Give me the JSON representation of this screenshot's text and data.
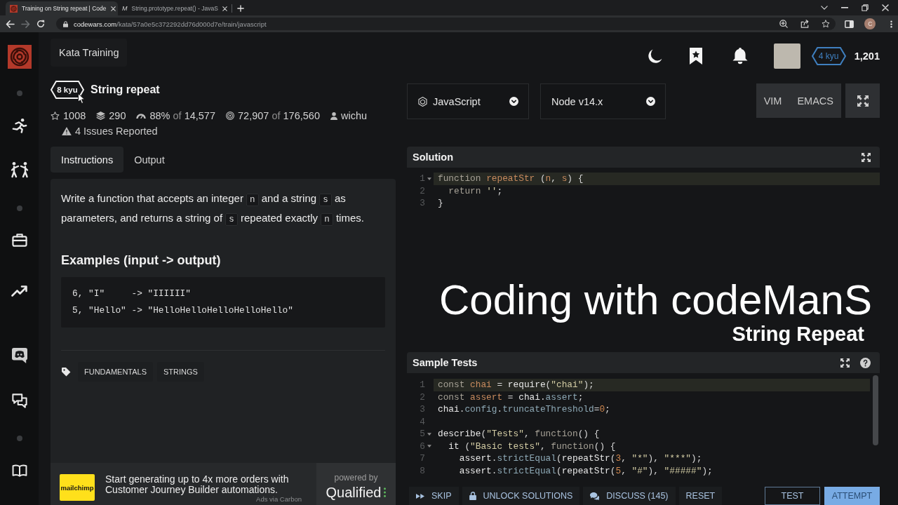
{
  "browser": {
    "tabs": [
      {
        "favicon": {
          "kind": "logo"
        },
        "title": "Training on String repeat | Code",
        "selected": true
      },
      {
        "favicon": {
          "kind": "letter",
          "text": "M"
        },
        "title": "String.prototype.repeat() - JavaS",
        "selected": false
      }
    ],
    "nav": {
      "back_disabled": false,
      "forward_disabled": true
    },
    "address": {
      "domain": "codewars.com",
      "path": "/kata/57a0e5c372292dd76d000d7e/train/javascript"
    },
    "profile_initial": "C"
  },
  "topbar": {
    "title": "Kata Training",
    "rank": "4 kyu",
    "honor": "1,201"
  },
  "kata": {
    "rank": "8 kyu",
    "title": "String repeat",
    "stats": [
      {
        "kind": "stars",
        "value": "1008"
      },
      {
        "kind": "collections",
        "value": "290"
      },
      {
        "kind": "satisfaction",
        "value": "88%",
        "of": "of",
        "total": "14,577"
      },
      {
        "kind": "completions",
        "value": "72,907",
        "of": "of",
        "total": "176,560"
      },
      {
        "kind": "author",
        "value": "wichu"
      }
    ],
    "issues": "4 Issues Reported"
  },
  "tabs": [
    {
      "label": "Instructions",
      "selected": true
    },
    {
      "label": "Output",
      "selected": false
    }
  ],
  "instructions": {
    "paragraph": [
      {
        "kind": "text",
        "text": "Write a function that accepts an integer "
      },
      {
        "kind": "code",
        "text": "n"
      },
      {
        "kind": "text",
        "text": " and a string "
      },
      {
        "kind": "code",
        "text": "s"
      },
      {
        "kind": "text",
        "text": " as parameters, and returns a string of "
      },
      {
        "kind": "code",
        "text": "s"
      },
      {
        "kind": "text",
        "text": " repeated exactly "
      },
      {
        "kind": "code",
        "text": "n"
      },
      {
        "kind": "text",
        "text": " times."
      }
    ],
    "examples_heading": "Examples (input -> output)",
    "examples": [
      "6, \"I\"     -> \"IIIIII\"",
      "5, \"Hello\" -> \"HelloHelloHelloHelloHello\""
    ],
    "tags": [
      "FUNDAMENTALS",
      "STRINGS"
    ]
  },
  "ad": {
    "logo": "mailchimp",
    "text": "Start generating up to 4x more orders with Customer Journey Builder automations.",
    "credit": "Ads via Carbon",
    "powered_by": "powered by",
    "sponsor": "Qualified"
  },
  "editor": {
    "language": "JavaScript",
    "version": "Node v14.x",
    "modes": [
      {
        "label": "VIM",
        "selected": false
      },
      {
        "label": "EMACS",
        "selected": false
      }
    ]
  },
  "solution": {
    "title": "Solution",
    "lines": [
      {
        "number": "1",
        "foldable": true,
        "active": true,
        "tokens": [
          {
            "kind": "keyword",
            "text": "function "
          },
          {
            "kind": "def",
            "text": "repeatStr"
          },
          {
            "kind": "punct",
            "text": " ("
          },
          {
            "kind": "param",
            "text": "n"
          },
          {
            "kind": "punct",
            "text": ", "
          },
          {
            "kind": "param",
            "text": "s"
          },
          {
            "kind": "punct",
            "text": ") {"
          }
        ]
      },
      {
        "number": "2",
        "foldable": false,
        "active": false,
        "tokens": [
          {
            "kind": "keyword",
            "text": "  return "
          },
          {
            "kind": "string",
            "text": "''"
          },
          {
            "kind": "punct",
            "text": ";"
          }
        ]
      },
      {
        "number": "3",
        "foldable": false,
        "active": false,
        "tokens": [
          {
            "kind": "punct",
            "text": "}"
          }
        ]
      }
    ]
  },
  "overlay": {
    "title": "Coding with codeManS",
    "subtitle": "String Repeat"
  },
  "sample_tests": {
    "title": "Sample Tests",
    "lines": [
      {
        "number": "1",
        "foldable": false,
        "active": true,
        "tokens": [
          {
            "kind": "keyword",
            "text": "const "
          },
          {
            "kind": "def",
            "text": "chai"
          },
          {
            "kind": "punct",
            "text": " = "
          },
          {
            "kind": "variable",
            "text": "require"
          },
          {
            "kind": "punct",
            "text": "("
          },
          {
            "kind": "string",
            "text": "\"chai\""
          },
          {
            "kind": "punct",
            "text": ");"
          }
        ]
      },
      {
        "number": "2",
        "foldable": false,
        "active": false,
        "tokens": [
          {
            "kind": "keyword",
            "text": "const "
          },
          {
            "kind": "def",
            "text": "assert"
          },
          {
            "kind": "punct",
            "text": " = "
          },
          {
            "kind": "variable",
            "text": "chai"
          },
          {
            "kind": "punct",
            "text": "."
          },
          {
            "kind": "property",
            "text": "assert"
          },
          {
            "kind": "punct",
            "text": ";"
          }
        ]
      },
      {
        "number": "3",
        "foldable": false,
        "active": false,
        "tokens": [
          {
            "kind": "variable",
            "text": "chai"
          },
          {
            "kind": "punct",
            "text": "."
          },
          {
            "kind": "property",
            "text": "config"
          },
          {
            "kind": "punct",
            "text": "."
          },
          {
            "kind": "property",
            "text": "truncateThreshold"
          },
          {
            "kind": "punct",
            "text": "="
          },
          {
            "kind": "number",
            "text": "0"
          },
          {
            "kind": "punct",
            "text": ";"
          }
        ]
      },
      {
        "number": "4",
        "foldable": false,
        "active": false
      },
      {
        "number": "5",
        "foldable": true,
        "active": false,
        "tokens": [
          {
            "kind": "variable",
            "text": "describe"
          },
          {
            "kind": "punct",
            "text": "("
          },
          {
            "kind": "string",
            "text": "\"Tests\""
          },
          {
            "kind": "punct",
            "text": ", "
          },
          {
            "kind": "keyword",
            "text": "function"
          },
          {
            "kind": "punct",
            "text": "() {"
          }
        ]
      },
      {
        "number": "6",
        "foldable": true,
        "active": false,
        "tokens": [
          {
            "kind": "variable",
            "text": "  it"
          },
          {
            "kind": "punct",
            "text": " ("
          },
          {
            "kind": "string",
            "text": "\"Basic tests\""
          },
          {
            "kind": "punct",
            "text": ", "
          },
          {
            "kind": "keyword",
            "text": "function"
          },
          {
            "kind": "punct",
            "text": "() {"
          }
        ]
      },
      {
        "number": "7",
        "foldable": false,
        "active": false,
        "tokens": [
          {
            "kind": "variable",
            "text": "    assert"
          },
          {
            "kind": "punct",
            "text": "."
          },
          {
            "kind": "property",
            "text": "strictEqual"
          },
          {
            "kind": "punct",
            "text": "("
          },
          {
            "kind": "variable",
            "text": "repeatStr"
          },
          {
            "kind": "punct",
            "text": "("
          },
          {
            "kind": "number",
            "text": "3"
          },
          {
            "kind": "punct",
            "text": ", "
          },
          {
            "kind": "string",
            "text": "\"*\""
          },
          {
            "kind": "punct",
            "text": "), "
          },
          {
            "kind": "string",
            "text": "\"***\""
          },
          {
            "kind": "punct",
            "text": ");"
          }
        ]
      },
      {
        "number": "8",
        "foldable": false,
        "active": false,
        "tokens": [
          {
            "kind": "variable",
            "text": "    assert"
          },
          {
            "kind": "punct",
            "text": "."
          },
          {
            "kind": "property",
            "text": "strictEqual"
          },
          {
            "kind": "punct",
            "text": "("
          },
          {
            "kind": "variable",
            "text": "repeatStr"
          },
          {
            "kind": "punct",
            "text": "("
          },
          {
            "kind": "number",
            "text": "5"
          },
          {
            "kind": "punct",
            "text": ", "
          },
          {
            "kind": "string",
            "text": "\"#\""
          },
          {
            "kind": "punct",
            "text": "), "
          },
          {
            "kind": "string",
            "text": "\"#####\""
          },
          {
            "kind": "punct",
            "text": ");"
          }
        ]
      }
    ]
  },
  "actions": [
    {
      "kind": "skip",
      "label": "SKIP"
    },
    {
      "kind": "unlock",
      "label": "UNLOCK SOLUTIONS"
    },
    {
      "kind": "discuss",
      "label": "DISCUSS (145)"
    },
    {
      "kind": "reset",
      "label": "RESET"
    }
  ],
  "buttons": [
    {
      "kind": "test",
      "label": "TEST"
    },
    {
      "kind": "attempt",
      "label": "ATTEMPT"
    }
  ]
}
